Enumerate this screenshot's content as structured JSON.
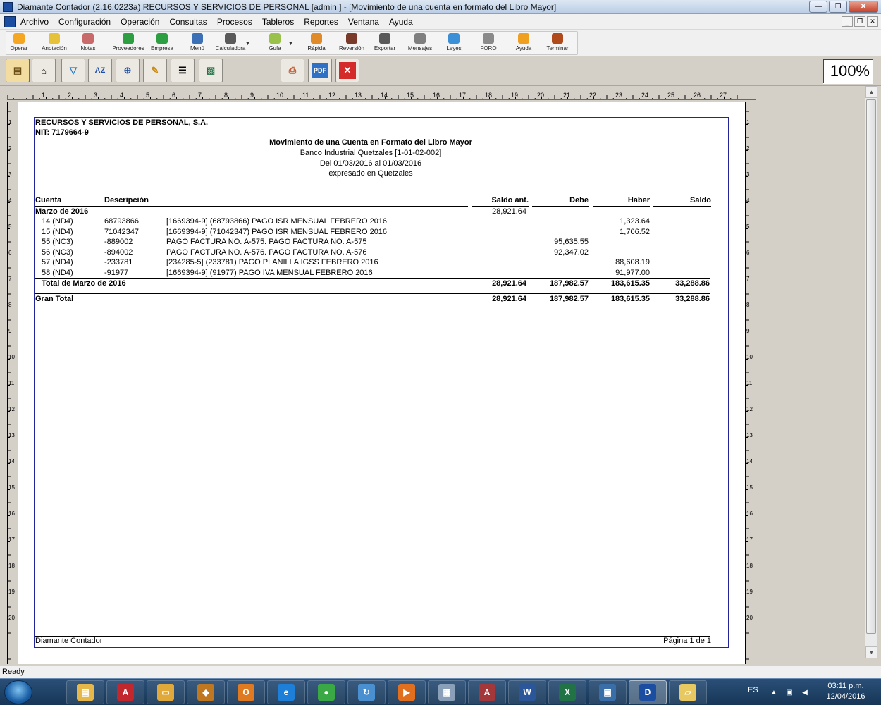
{
  "window": {
    "title": "Diamante Contador (2.16.0223a) RECURSOS Y SERVICIOS DE PERSONAL  [admin ]  - [Movimiento de una cuenta en formato del Libro Mayor]"
  },
  "menu": [
    "Archivo",
    "Configuración",
    "Operación",
    "Consultas",
    "Procesos",
    "Tableros",
    "Reportes",
    "Ventana",
    "Ayuda"
  ],
  "toolbar": [
    {
      "label": "Operar",
      "icon": "lightning-icon",
      "color": "#f5a623"
    },
    {
      "label": "Anotación",
      "icon": "note-icon",
      "color": "#e6c23a"
    },
    {
      "label": "Notas",
      "icon": "notes-icon",
      "color": "#c96a6a"
    },
    {
      "label": "Proveedores",
      "icon": "suppliers-icon",
      "color": "#2e9e43"
    },
    {
      "label": "Empresa",
      "icon": "company-icon",
      "color": "#2e9e43"
    },
    {
      "label": "Menú",
      "icon": "menu-icon",
      "color": "#3b6fb6"
    },
    {
      "label": "Calculadora",
      "icon": "calculator-icon",
      "color": "#5a5a5a"
    },
    {
      "label": "Guía",
      "icon": "guide-icon",
      "color": "#9ac24a"
    },
    {
      "label": "Rápida",
      "icon": "quick-icon",
      "color": "#e08a2a"
    },
    {
      "label": "Reversión",
      "icon": "reversal-icon",
      "color": "#7a3a2a"
    },
    {
      "label": "Exportar",
      "icon": "export-icon",
      "color": "#5a5a5a"
    },
    {
      "label": "Mensajes",
      "icon": "messages-icon",
      "color": "#7f7f7f"
    },
    {
      "label": "Leyes",
      "icon": "laws-icon",
      "color": "#3b8fd6"
    },
    {
      "label": "FORO",
      "icon": "forum-icon",
      "color": "#8a8a8a"
    },
    {
      "label": "Ayuda",
      "icon": "help-icon",
      "color": "#f0a020"
    },
    {
      "label": "Terminar",
      "icon": "exit-icon",
      "color": "#b04a1a"
    }
  ],
  "report_toolbar": {
    "zoom": "100%",
    "buttons": [
      "setup-icon",
      "home-icon",
      "filter-icon",
      "sort-az-icon",
      "zoom-in-icon",
      "highlight-icon",
      "lines-icon",
      "excel-export-icon",
      "print-icon",
      "pdf-icon",
      "close-icon"
    ]
  },
  "ruler": {
    "h_numbers": [
      "1",
      "2",
      "3",
      "4",
      "5",
      "6",
      "7",
      "8",
      "9",
      "10",
      "11",
      "12",
      "13",
      "14",
      "15",
      "16",
      "17",
      "18",
      "19",
      "20",
      "21",
      "22",
      "23",
      "24",
      "25",
      "26",
      "27"
    ],
    "v_numbers": [
      "1",
      "2",
      "3",
      "4",
      "5",
      "6",
      "7",
      "8",
      "9",
      "10",
      "11",
      "12",
      "13",
      "14",
      "15",
      "16",
      "17",
      "18",
      "19",
      "20"
    ]
  },
  "report": {
    "company": "RECURSOS Y SERVICIOS DE PERSONAL, S.A.",
    "nit": "NIT: 7179664-9",
    "title": "Movimiento de una Cuenta en Formato del Libro Mayor",
    "account": "Banco Industrial Quetzales [1-01-02-002]",
    "period": "Del 01/03/2016 al 01/03/2016",
    "currency": "expresado en Quetzales",
    "headers": {
      "cuenta": "Cuenta",
      "descripcion": "Descripción",
      "saldo_ant": "Saldo ant.",
      "debe": "Debe",
      "haber": "Haber",
      "saldo": "Saldo"
    },
    "group": {
      "label": "Marzo de 2016",
      "saldo_ant": "28,921.64"
    },
    "rows": [
      {
        "cuenta": "14 (ND4)",
        "doc": "68793866",
        "desc": "[1669394-9] (68793866) PAGO ISR MENSUAL FEBRERO 2016",
        "debe": "",
        "haber": "1,323.64"
      },
      {
        "cuenta": "15 (ND4)",
        "doc": "71042347",
        "desc": "[1669394-9] (71042347) PAGO ISR MENSUAL FEBRERO 2016",
        "debe": "",
        "haber": "1,706.52"
      },
      {
        "cuenta": "55 (NC3)",
        "doc": "-889002",
        "desc": "PAGO FACTURA NO. A-575. PAGO FACTURA NO. A-575",
        "debe": "95,635.55",
        "haber": ""
      },
      {
        "cuenta": "56 (NC3)",
        "doc": "-894002",
        "desc": "PAGO FACTURA NO. A-576. PAGO FACTURA NO. A-576",
        "debe": "92,347.02",
        "haber": ""
      },
      {
        "cuenta": "57 (ND4)",
        "doc": "-233781",
        "desc": "[234285-5] (233781) PAGO PLANILLA IGSS FEBRERO 2016",
        "debe": "",
        "haber": "88,608.19"
      },
      {
        "cuenta": "58 (ND4)",
        "doc": "-91977",
        "desc": "[1669394-9] (91977) PAGO IVA MENSUAL FEBRERO 2016",
        "debe": "",
        "haber": "91,977.00"
      }
    ],
    "subtotal": {
      "label": "Total de Marzo de 2016",
      "saldo_ant": "28,921.64",
      "debe": "187,982.57",
      "haber": "183,615.35",
      "saldo": "33,288.86"
    },
    "total": {
      "label": "Gran Total",
      "saldo_ant": "28,921.64",
      "debe": "187,982.57",
      "haber": "183,615.35",
      "saldo": "33,288.86"
    },
    "footer_left": "Diamante Contador",
    "footer_right": "Página 1 de 1"
  },
  "status": "Ready",
  "taskbar": {
    "apps": [
      {
        "name": "explorer-icon",
        "color": "#e6b84a",
        "glyph": "▤"
      },
      {
        "name": "acrobat-icon",
        "color": "#c1272d",
        "glyph": "A"
      },
      {
        "name": "folder-icon",
        "color": "#e0a93a",
        "glyph": "▭"
      },
      {
        "name": "diamante-icon",
        "color": "#c07820",
        "glyph": "◆"
      },
      {
        "name": "outlook-icon",
        "color": "#e07a20",
        "glyph": "O"
      },
      {
        "name": "internet-explorer-icon",
        "color": "#1e7fd8",
        "glyph": "e"
      },
      {
        "name": "chrome-icon",
        "color": "#3aa845",
        "glyph": "●"
      },
      {
        "name": "remote-icon",
        "color": "#4a8fd0",
        "glyph": "↻"
      },
      {
        "name": "media-icon",
        "color": "#e07020",
        "glyph": "▶"
      },
      {
        "name": "calculator-icon",
        "color": "#8aa0b8",
        "glyph": "▦"
      },
      {
        "name": "access-icon",
        "color": "#a4373a",
        "glyph": "A"
      },
      {
        "name": "word-icon",
        "color": "#2b579a",
        "glyph": "W"
      },
      {
        "name": "excel-icon",
        "color": "#217346",
        "glyph": "X"
      },
      {
        "name": "network-icon",
        "color": "#3a6ea8",
        "glyph": "▣"
      },
      {
        "name": "diamante-active-icon",
        "color": "#1b4ea1",
        "glyph": "D"
      },
      {
        "name": "notes-app-icon",
        "color": "#e8c860",
        "glyph": "▱"
      }
    ],
    "lang": "ES",
    "time": "03:11 p.m.",
    "date": "12/04/2016"
  }
}
